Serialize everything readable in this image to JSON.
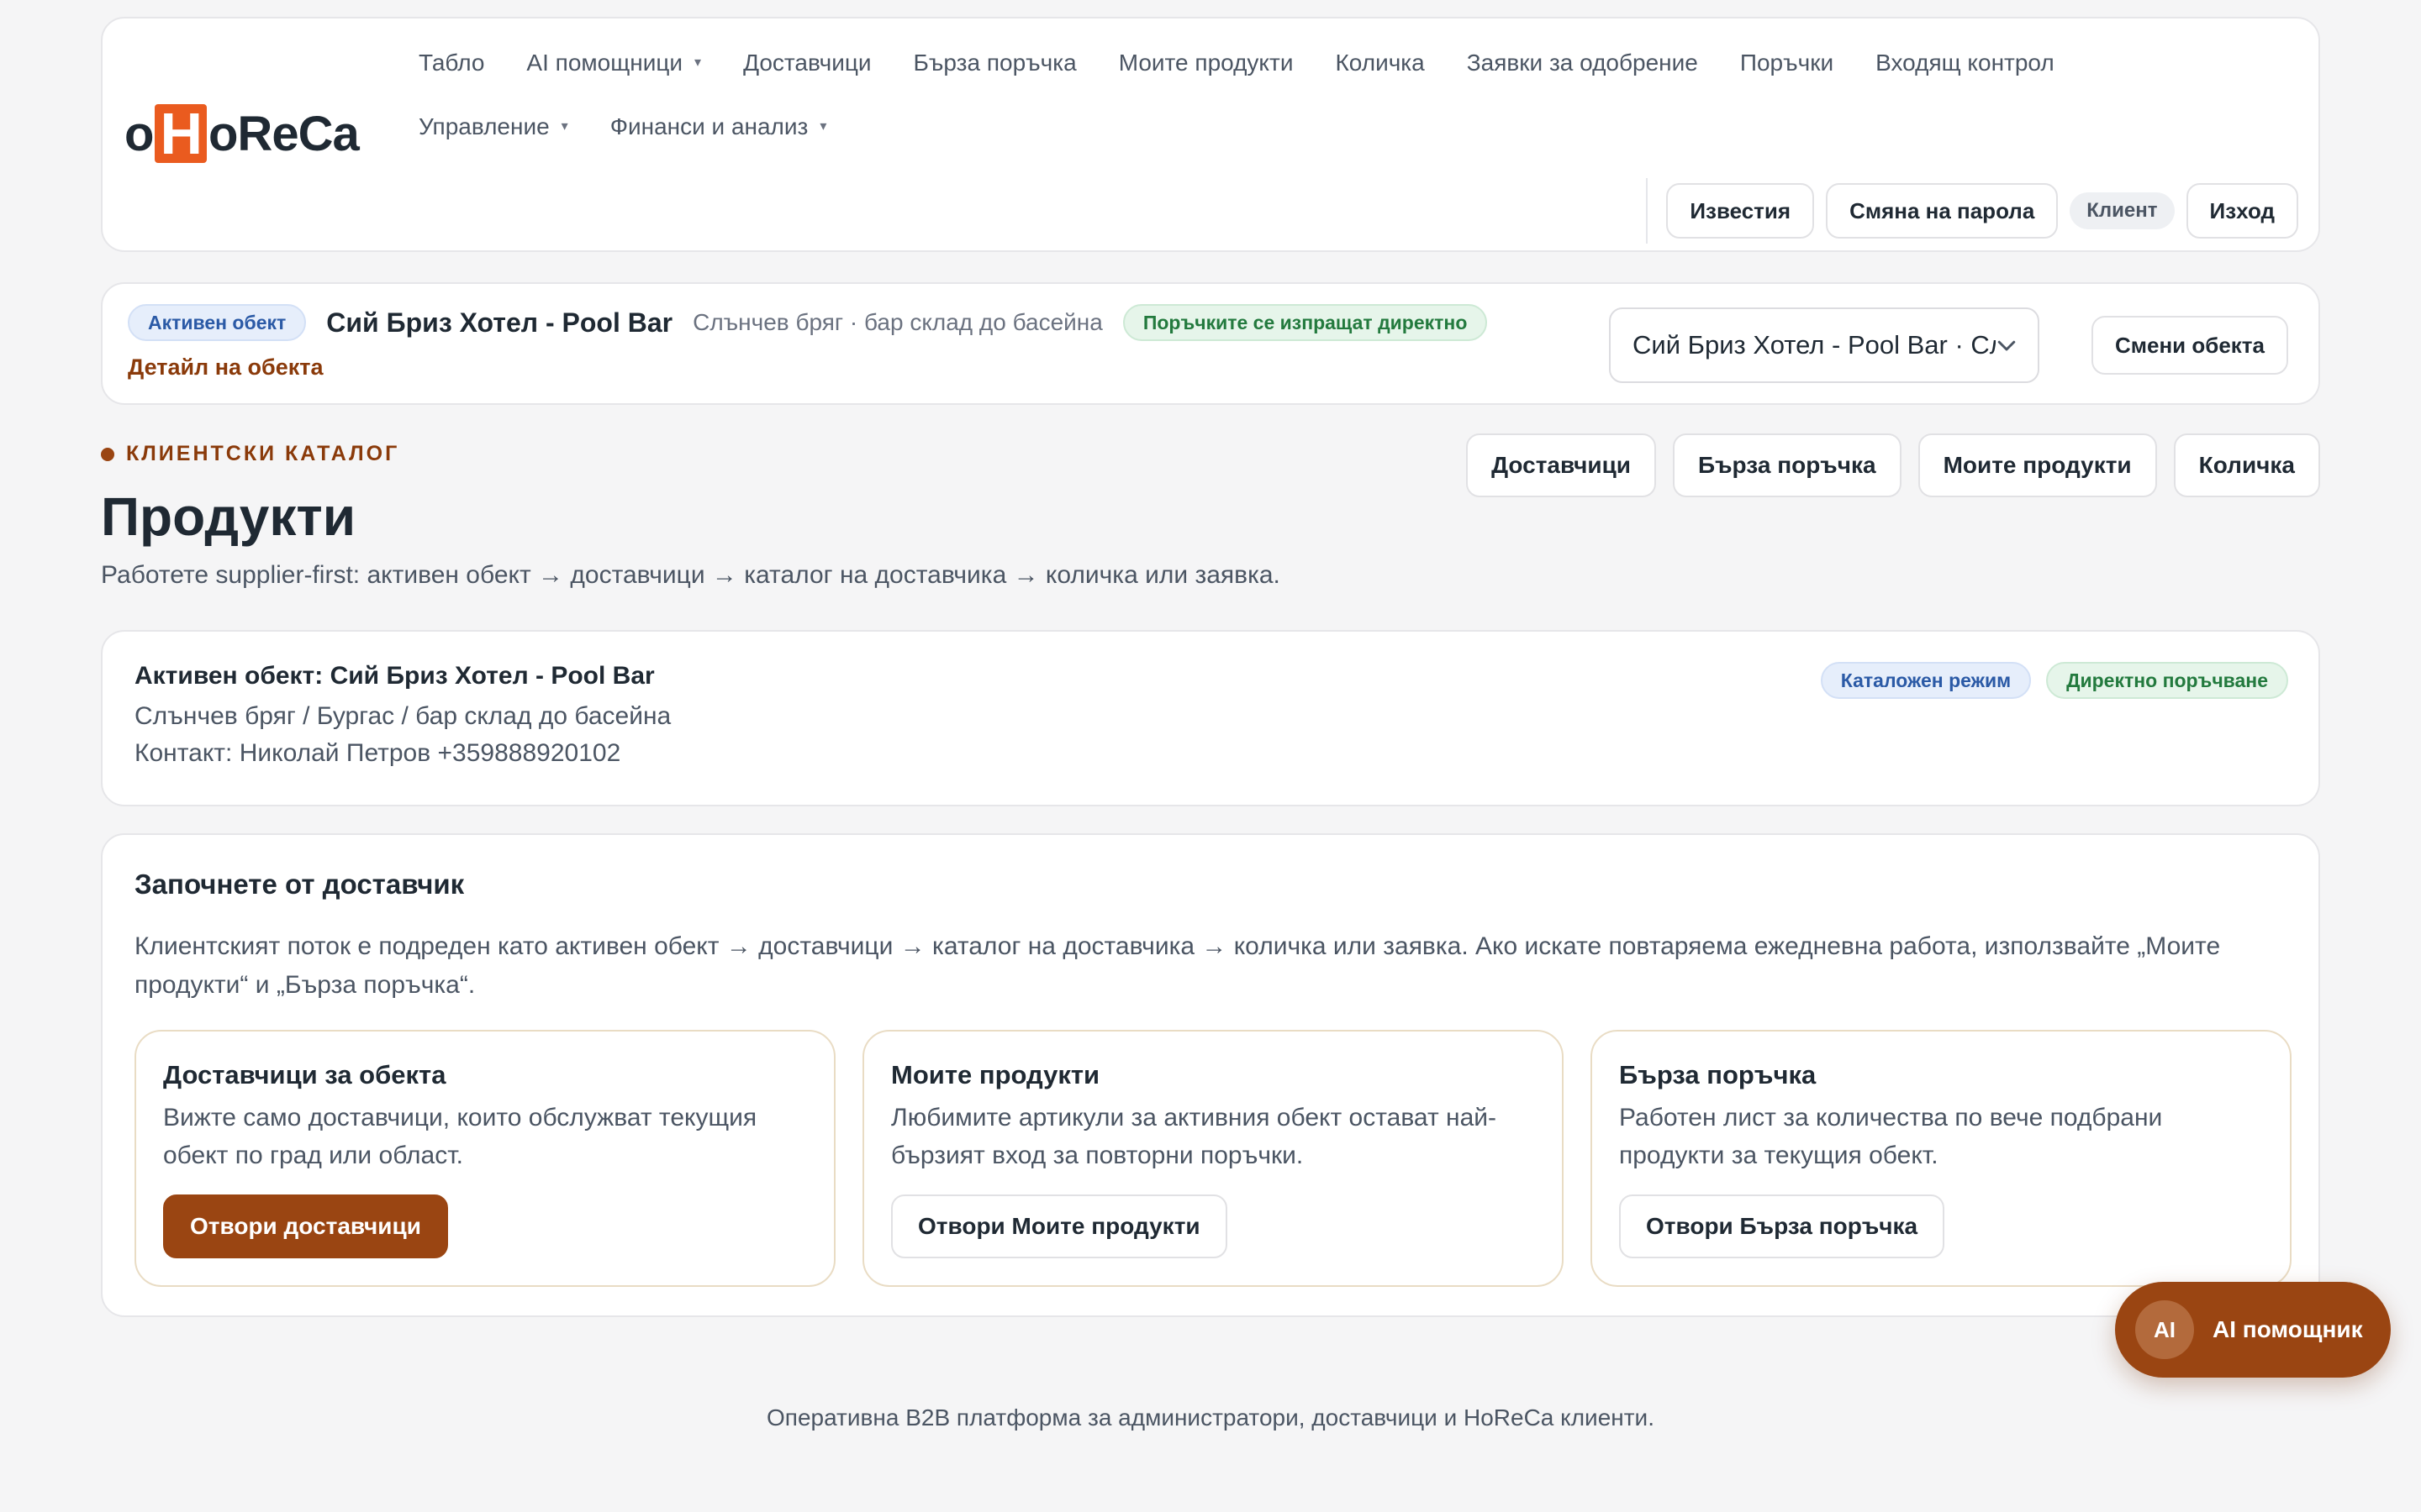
{
  "brand": {
    "logo_prefix": "o",
    "logo_mark": "H",
    "logo_suffix": "oReCa"
  },
  "nav": {
    "items": [
      {
        "label": "Табло",
        "dropdown": false
      },
      {
        "label": "AI помощници",
        "dropdown": true
      },
      {
        "label": "Доставчици",
        "dropdown": false
      },
      {
        "label": "Бърза поръчка",
        "dropdown": false
      },
      {
        "label": "Моите продукти",
        "dropdown": false
      },
      {
        "label": "Количка",
        "dropdown": false
      },
      {
        "label": "Заявки за одобрение",
        "dropdown": false
      },
      {
        "label": "Поръчки",
        "dropdown": false
      },
      {
        "label": "Входящ контрол",
        "dropdown": false
      },
      {
        "label": "Управление",
        "dropdown": true
      },
      {
        "label": "Финанси и анализ",
        "dropdown": true
      }
    ],
    "caret": "▾"
  },
  "header_actions": {
    "notifications": "Известия",
    "change_password": "Смяна на парола",
    "role": "Клиент",
    "logout": "Изход"
  },
  "object_bar": {
    "active_badge": "Активен обект",
    "name": "Сий Бриз Хотел - Pool Bar",
    "subtitle": "Слънчев бряг · бар склад до басейна",
    "direct_badge": "Поръчките се изпращат директно",
    "detail_link": "Детайл на обекта",
    "select_value": "Сий Бриз Хотел - Pool Bar · Слънчев бряг",
    "change_button": "Смени обекта"
  },
  "page": {
    "eyebrow": "КЛИЕНТСКИ КАТАЛОГ",
    "title": "Продукти",
    "subtitle": "Работете supplier-first: активен обект → доставчици → каталог на доставчика → количка или заявка.",
    "quick_links": [
      "Доставчици",
      "Бърза поръчка",
      "Моите продукти",
      "Количка"
    ]
  },
  "active_card": {
    "title": "Активен обект: Сий Бриз Хотел - Pool Bar",
    "location": "Слънчев бряг / Бургас / бар склад до басейна",
    "contact": "Контакт: Николай Петров +359888920102",
    "badge_catalog": "Каталожен режим",
    "badge_direct": "Директно поръчване"
  },
  "start_card": {
    "title": "Започнете от доставчик",
    "description": "Клиентският поток е подреден като активен обект → доставчици → каталог на доставчика → количка или заявка. Ако искате повтаряема ежедневна работа, използвайте „Моите продукти“ и „Бърза поръчка“.",
    "tiles": [
      {
        "title": "Доставчици за обекта",
        "description": "Вижте само доставчици, които обслужват текущия обект по град или област.",
        "button": "Отвори доставчици",
        "primary": true
      },
      {
        "title": "Моите продукти",
        "description": "Любимите артикули за активния обект остават най-бързият вход за повторни поръчки.",
        "button": "Отвори Моите продукти",
        "primary": false
      },
      {
        "title": "Бърза поръчка",
        "description": "Работен лист за количества по вече подбрани продукти за текущия обект.",
        "button": "Отвори Бърза поръчка",
        "primary": false
      }
    ]
  },
  "footer": {
    "text": "Оперативна B2B платформа за администратори, доставчици и HoReCa клиенти."
  },
  "fab": {
    "badge": "AI",
    "label": "AI помощник"
  },
  "colors": {
    "accent": "#9a4512",
    "logo_orange": "#ea5b1f",
    "blue_badge": "#2b5aa6",
    "green_badge": "#237a3e"
  }
}
